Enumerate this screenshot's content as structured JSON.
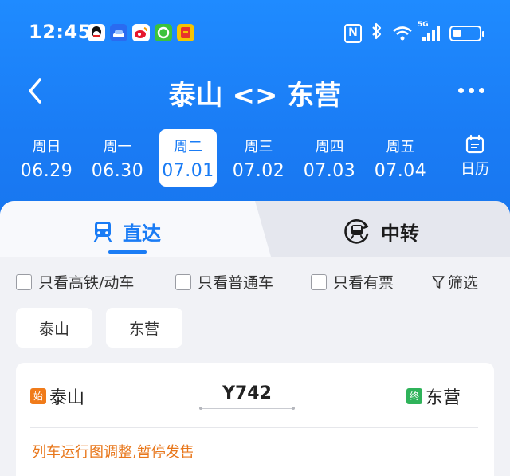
{
  "status_bar": {
    "time": "12:45",
    "network": "5G",
    "notification_icons": [
      "qq-icon",
      "car-app-icon",
      "weibo-icon",
      "green-app-icon",
      "red-app-icon"
    ]
  },
  "title_bar": {
    "title": "泰山 <> 东营"
  },
  "dates": [
    {
      "weekday": "周日",
      "date": "06.29",
      "selected": false
    },
    {
      "weekday": "周一",
      "date": "06.30",
      "selected": false
    },
    {
      "weekday": "周二",
      "date": "07.01",
      "selected": true
    },
    {
      "weekday": "周三",
      "date": "07.02",
      "selected": false
    },
    {
      "weekday": "周四",
      "date": "07.03",
      "selected": false
    },
    {
      "weekday": "周五",
      "date": "07.04",
      "selected": false
    }
  ],
  "calendar_label": "日历",
  "tabs": {
    "direct": "直达",
    "transfer": "中转"
  },
  "filters": {
    "high_speed": "只看高铁/动车",
    "regular": "只看普通车",
    "available": "只看有票",
    "filter_button": "筛选"
  },
  "stations": {
    "from": "泰山",
    "to": "东营"
  },
  "train": {
    "start_tag": "始",
    "from": "泰山",
    "number": "Y742",
    "end_tag": "终",
    "to": "东营",
    "notice": "列车运行图调整,暂停发售"
  },
  "colors": {
    "primary": "#1a7cf5",
    "start_tag": "#f07b1a",
    "end_tag": "#2fb35a",
    "notice": "#e8771b"
  }
}
